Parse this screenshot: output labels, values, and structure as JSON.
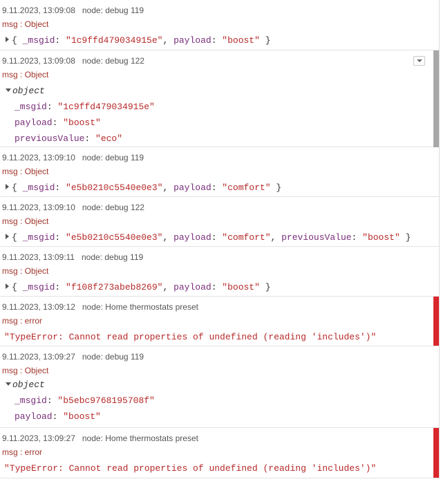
{
  "messages": [
    {
      "timestamp": "9.11.2023, 13:09:08",
      "node": "node: debug 119",
      "topic": "msg : Object",
      "summary": {
        "open": "{ ",
        "k1": "_msgid",
        "v1": "\"1c9ffd479034915e\"",
        "k2": "payload",
        "v2": "\"boost\"",
        "close": " }"
      }
    },
    {
      "timestamp": "9.11.2023, 13:09:08",
      "node": "node: debug 122",
      "topic": "msg : Object",
      "object_label": "object",
      "props": [
        {
          "key": "_msgid",
          "value": "\"1c9ffd479034915e\""
        },
        {
          "key": "payload",
          "value": "\"boost\""
        },
        {
          "key": "previousValue",
          "value": "\"eco\""
        }
      ]
    },
    {
      "timestamp": "9.11.2023, 13:09:10",
      "node": "node: debug 119",
      "topic": "msg : Object",
      "summary": {
        "open": "{ ",
        "k1": "_msgid",
        "v1": "\"e5b0210c5540e0e3\"",
        "k2": "payload",
        "v2": "\"comfort\"",
        "close": " }"
      }
    },
    {
      "timestamp": "9.11.2023, 13:09:10",
      "node": "node: debug 122",
      "topic": "msg : Object",
      "summary": {
        "open": "{ ",
        "k1": "_msgid",
        "v1": "\"e5b0210c5540e0e3\"",
        "k2": "payload",
        "v2": "\"comfort\"",
        "k3": "previousValue",
        "v3": "\"boost\"",
        "close": " }"
      }
    },
    {
      "timestamp": "9.11.2023, 13:09:11",
      "node": "node: debug 119",
      "topic": "msg : Object",
      "summary": {
        "open": "{ ",
        "k1": "_msgid",
        "v1": "\"f108f273abeb8269\"",
        "k2": "payload",
        "v2": "\"boost\"",
        "close": " }"
      }
    },
    {
      "timestamp": "9.11.2023, 13:09:12",
      "node": "node: Home thermostats preset",
      "topic": "msg : error",
      "error": "\"TypeError: Cannot read properties of undefined (reading 'includes')\""
    },
    {
      "timestamp": "9.11.2023, 13:09:27",
      "node": "node: debug 119",
      "topic": "msg : Object",
      "object_label": "object",
      "props": [
        {
          "key": "_msgid",
          "value": "\"b5ebc9768195708f\""
        },
        {
          "key": "payload",
          "value": "\"boost\""
        }
      ]
    },
    {
      "timestamp": "9.11.2023, 13:09:27",
      "node": "node: Home thermostats preset",
      "topic": "msg : error",
      "error": "\"TypeError: Cannot read properties of undefined (reading 'includes')\""
    }
  ],
  "sep": ": ",
  "comma": ", ",
  "colors": {
    "topic": "#a1362b",
    "key": "#792e7a",
    "string": "#b72828",
    "error_bar": "#d9262c"
  },
  "icons": {
    "expand": "caret-right-icon",
    "collapse": "caret-down-icon",
    "menu": "chevron-down-icon"
  }
}
